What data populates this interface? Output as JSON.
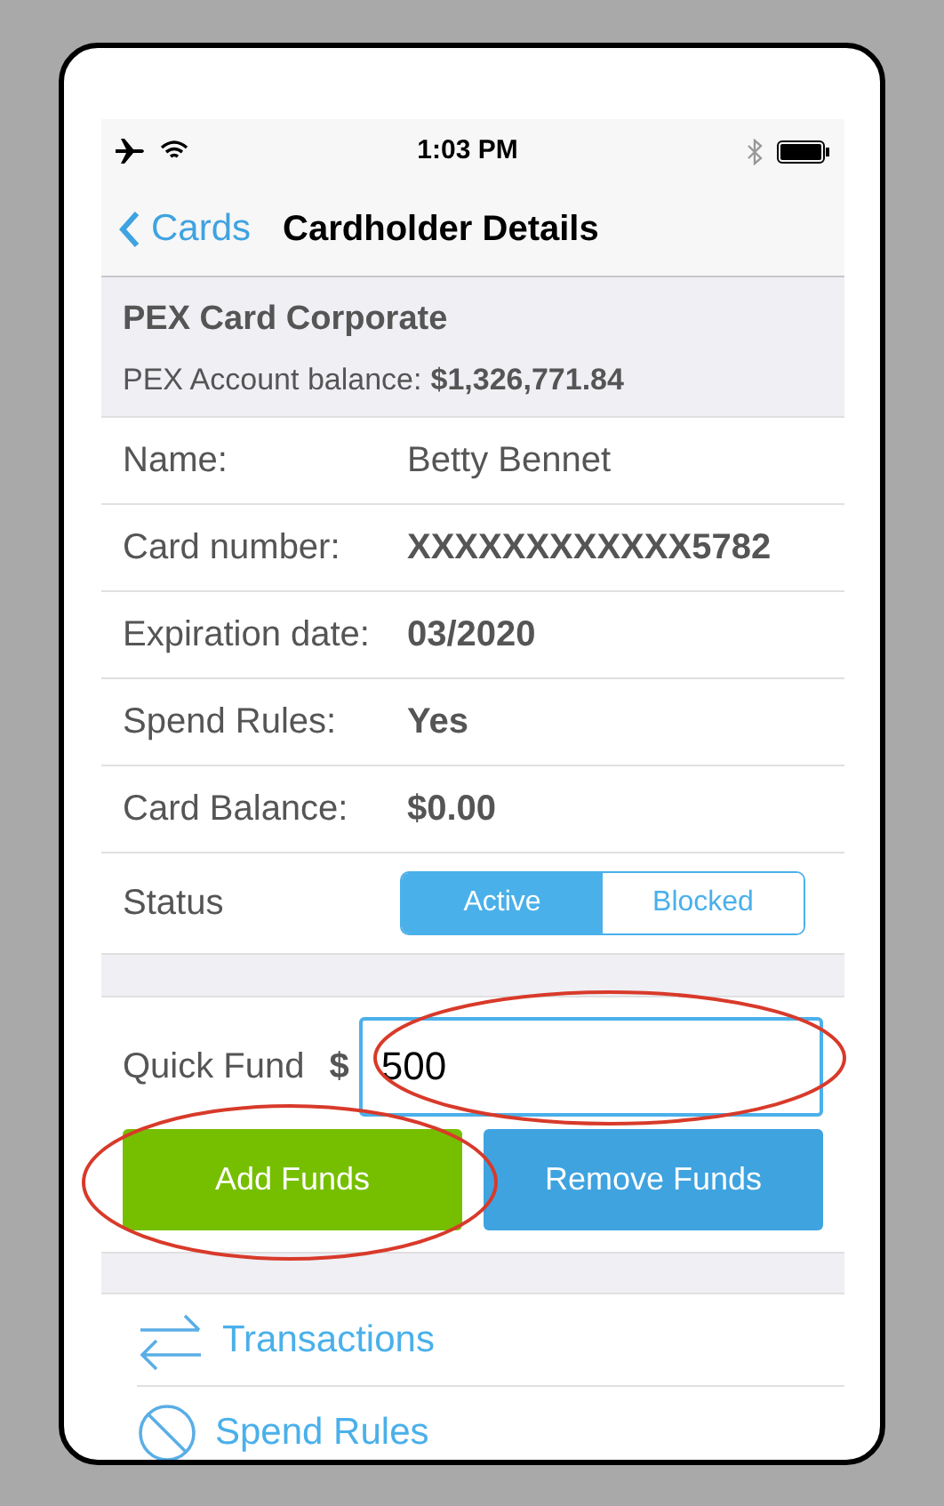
{
  "status_bar": {
    "time": "1:03 PM"
  },
  "nav": {
    "back": "Cards",
    "title": "Cardholder Details"
  },
  "account": {
    "name": "PEX Card Corporate",
    "balance_label": "PEX Account balance:",
    "balance": "$1,326,771.84"
  },
  "details": [
    {
      "label": "Name:",
      "value": "Betty Bennet",
      "bold": false
    },
    {
      "label": "Card number:",
      "value": "XXXXXXXXXXXX5782",
      "bold": true
    },
    {
      "label": "Expiration date:",
      "value": "03/2020",
      "bold": true
    },
    {
      "label": "Spend Rules:",
      "value": "Yes",
      "bold": true
    },
    {
      "label": "Card Balance:",
      "value": "$0.00",
      "bold": true
    }
  ],
  "status": {
    "label": "Status",
    "options": [
      {
        "label": "Active",
        "selected": true
      },
      {
        "label": "Blocked",
        "selected": false
      }
    ]
  },
  "quick_fund": {
    "label": "Quick Fund",
    "currency": "$",
    "value": "500"
  },
  "buttons": [
    {
      "label": "Add Funds",
      "kind": "add"
    },
    {
      "label": "Remove Funds",
      "kind": "remove"
    }
  ],
  "menu": [
    {
      "label": "Transactions",
      "kind": "transactions"
    },
    {
      "label": "Spend Rules",
      "kind": "rules"
    }
  ]
}
